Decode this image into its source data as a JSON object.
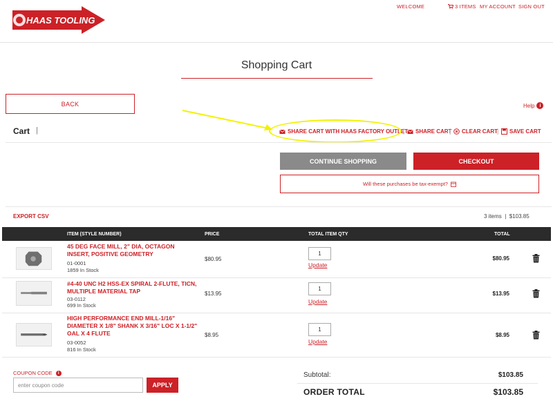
{
  "header": {
    "logo_text": "HAAS TOOLING",
    "nav": {
      "welcome": "WELCOME",
      "cart_count": "3 ITEMS",
      "my_account": "MY ACCOUNT",
      "sign_out": "SIGN OUT"
    }
  },
  "page": {
    "title": "Shopping Cart",
    "back_label": "BACK",
    "help_label": "Help"
  },
  "cart": {
    "heading": "Cart",
    "separator": "|",
    "actions": {
      "share_outlet": "SHARE CART WITH HAAS FACTORY OUTLET",
      "share_cart": "SHARE CART",
      "clear_cart": "CLEAR CART",
      "save_cart": "SAVE CART"
    },
    "continue_label": "CONTINUE SHOPPING",
    "checkout_label": "CHECKOUT",
    "tax_exempt_label": "Will these purchases be tax-exempt?",
    "export_csv": "EXPORT CSV",
    "summary": "3 items  |  $103.85"
  },
  "table": {
    "headers": {
      "item": "ITEM (STYLE NUMBER)",
      "price": "PRICE",
      "qty": "TOTAL ITEM QTY",
      "total": "TOTAL"
    },
    "rows": [
      {
        "name": "45 DEG FACE MILL, 2\" DIA, OCTAGON INSERT, POSITIVE GEOMETRY",
        "sku": "01-0001",
        "stock": "1859 In Stock",
        "price": "$80.95",
        "qty": "1",
        "update": "Update",
        "total": "$80.95"
      },
      {
        "name": "#4-40 UNC H2 HSS-EX SPIRAL 2-FLUTE, TICN, MULTIPLE MATERIAL TAP",
        "sku": "03-0112",
        "stock": "699 In Stock",
        "price": "$13.95",
        "qty": "1",
        "update": "Update",
        "total": "$13.95"
      },
      {
        "name": "HIGH PERFORMANCE END MILL-1/16\" DIAMETER X 1/8\" SHANK X 3/16\" LOC X 1-1/2\" OAL X 4 FLUTE",
        "sku": "03-0052",
        "stock": "816 In Stock",
        "price": "$8.95",
        "qty": "1",
        "update": "Update",
        "total": "$8.95"
      }
    ]
  },
  "coupon": {
    "label": "COUPON CODE",
    "placeholder": "enter coupon code",
    "apply_label": "APPLY"
  },
  "totals": {
    "subtotal_label": "Subtotal:",
    "subtotal_value": "$103.85",
    "order_total_label": "ORDER TOTAL",
    "order_total_value": "$103.85"
  },
  "colors": {
    "brand_red": "#cc2127",
    "annotation_yellow": "#f2f200",
    "table_header": "#2b2b2b",
    "continue_gray": "#8a8a8a"
  },
  "icons": [
    "cart-icon",
    "help-icon",
    "email-icon",
    "clear-icon",
    "save-icon",
    "calendar-icon",
    "trash-icon",
    "info-icon"
  ]
}
